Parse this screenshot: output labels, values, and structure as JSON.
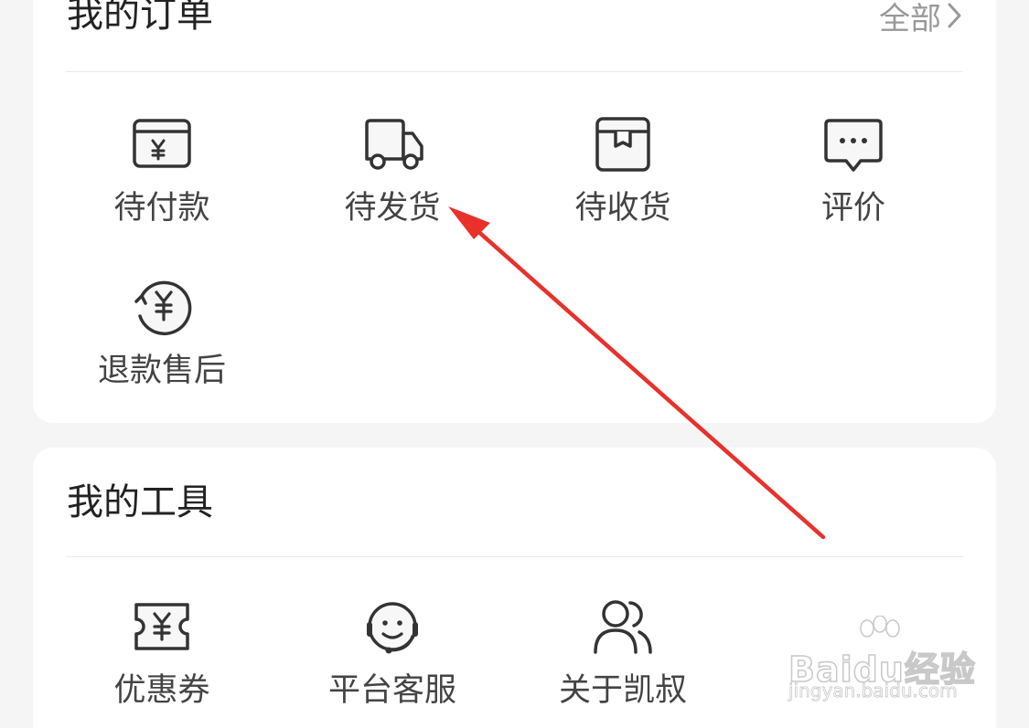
{
  "orders": {
    "title": "我的订单",
    "see_all": "全部",
    "items": [
      {
        "label": "待付款",
        "icon": "wallet-yuan-icon"
      },
      {
        "label": "待发货",
        "icon": "truck-icon"
      },
      {
        "label": "待收货",
        "icon": "package-box-icon"
      },
      {
        "label": "评价",
        "icon": "chat-bubble-icon"
      },
      {
        "label": "退款售后",
        "icon": "refund-yuan-icon"
      }
    ]
  },
  "tools": {
    "title": "我的工具",
    "items": [
      {
        "label": "优惠券",
        "icon": "coupon-ticket-icon"
      },
      {
        "label": "平台客服",
        "icon": "customer-service-headset-icon"
      },
      {
        "label": "关于凯叔",
        "icon": "users-group-icon"
      }
    ]
  },
  "watermark": {
    "logo": "Baidu经验",
    "url": "jingyan.baidu.com"
  },
  "colors": {
    "background": "#f5f5f5",
    "card": "#ffffff",
    "icon_stroke": "#333333",
    "label_text": "#444444",
    "muted_text": "#999999",
    "annotation_arrow": "#e8312b"
  }
}
